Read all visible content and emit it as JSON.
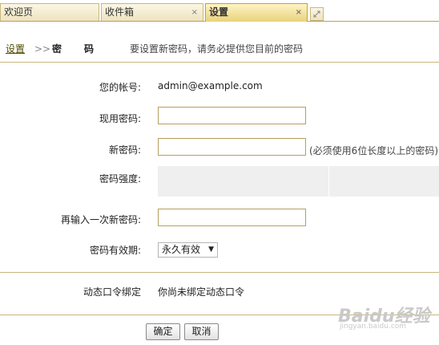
{
  "tabs": [
    {
      "label": "欢迎页"
    },
    {
      "label": "收件箱",
      "close": "×"
    },
    {
      "label": "设置",
      "close": "×"
    }
  ],
  "breadcrumb": {
    "link": "设置",
    "separator": ">>",
    "title": "密码",
    "hint": "要设置新密码，请务必提供您目前的密码"
  },
  "form": {
    "account_label": "您的帐号:",
    "account_value": "admin@example.com",
    "current_label": "现用密码:",
    "current_value": "",
    "new_label": "新密码:",
    "new_value": "",
    "new_hint": "(必须使用6位长度以上的密码)",
    "strength_label": "密码强度:",
    "confirm_label": "再输入一次新密码:",
    "confirm_value": "",
    "expiry_label": "密码有效期:",
    "expiry_selected": "永久有效"
  },
  "token": {
    "label": "动态口令绑定",
    "value": "你尚未绑定动态口令"
  },
  "buttons": {
    "ok": "确定",
    "cancel": "取消"
  },
  "watermark": {
    "brand": "Baidu经验",
    "url": "jingyan.baidu.com"
  }
}
